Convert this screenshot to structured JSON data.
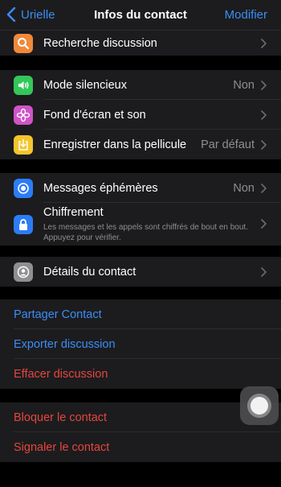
{
  "nav": {
    "back_label": "Urielle",
    "title": "Infos du contact",
    "edit_label": "Modifier"
  },
  "search": {
    "label": "Recherche discussion",
    "icon": "search-icon",
    "color": "#f08a3a"
  },
  "settings": [
    {
      "label": "Mode silencieux",
      "value": "Non",
      "icon": "speaker-icon",
      "color": "#33c759"
    },
    {
      "label": "Fond d'écran et son",
      "value": "",
      "icon": "flower-icon",
      "color": "#d154c7"
    },
    {
      "label": "Enregistrer dans la pellicule",
      "value": "Par défaut",
      "icon": "save-icon",
      "color": "#f5c52c"
    }
  ],
  "privacy": {
    "ephemeral": {
      "label": "Messages éphémères",
      "value": "Non",
      "icon": "timer-icon",
      "color": "#2c7cf6"
    },
    "encryption": {
      "label": "Chiffrement",
      "subtext": "Les messages et les appels sont chiffrés de bout en bout. Appuyez pour vérifier.",
      "icon": "lock-icon",
      "color": "#2c7cf6"
    }
  },
  "details": {
    "label": "Détails du contact",
    "icon": "contact-icon",
    "color": "#8e8e93"
  },
  "actions": {
    "share": "Partager Contact",
    "export": "Exporter discussion",
    "clear": "Effacer discussion"
  },
  "danger": {
    "block": "Bloquer le contact",
    "report": "Signaler le contact"
  },
  "colors": {
    "accent": "#3a8ef6",
    "destructive": "#e5463e",
    "background": "#000000",
    "cell": "#1c1c1e"
  }
}
